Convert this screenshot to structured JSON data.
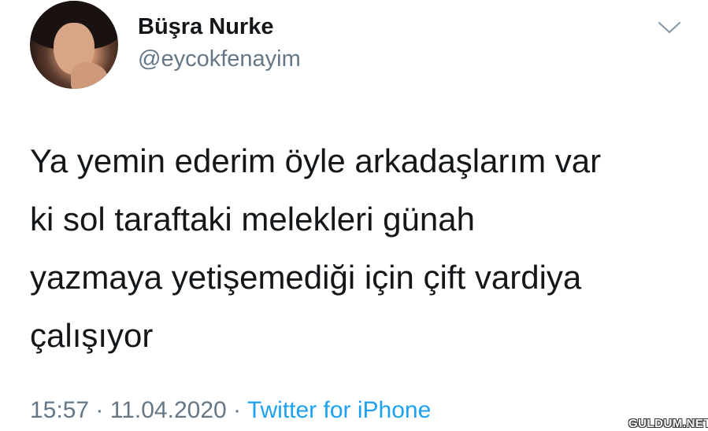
{
  "tweet": {
    "author": {
      "display_name": "Büşra Nurke",
      "handle": "@eycokfenayim",
      "avatar_icon": "profile-photo"
    },
    "menu_icon": "chevron-down-icon",
    "text": "Ya yemin ederim öyle arkadaşlarım var\nki sol taraftaki melekleri günah\nyazmaya yetişemediği için çift vardiya\nçalışıyor",
    "time": "15:57",
    "separator": "·",
    "date": "11.04.2020",
    "source": "Twitter for iPhone"
  },
  "watermark": "GULDUM.NET",
  "colors": {
    "text": "#14171a",
    "secondary": "#657786",
    "link": "#1da1f2"
  }
}
